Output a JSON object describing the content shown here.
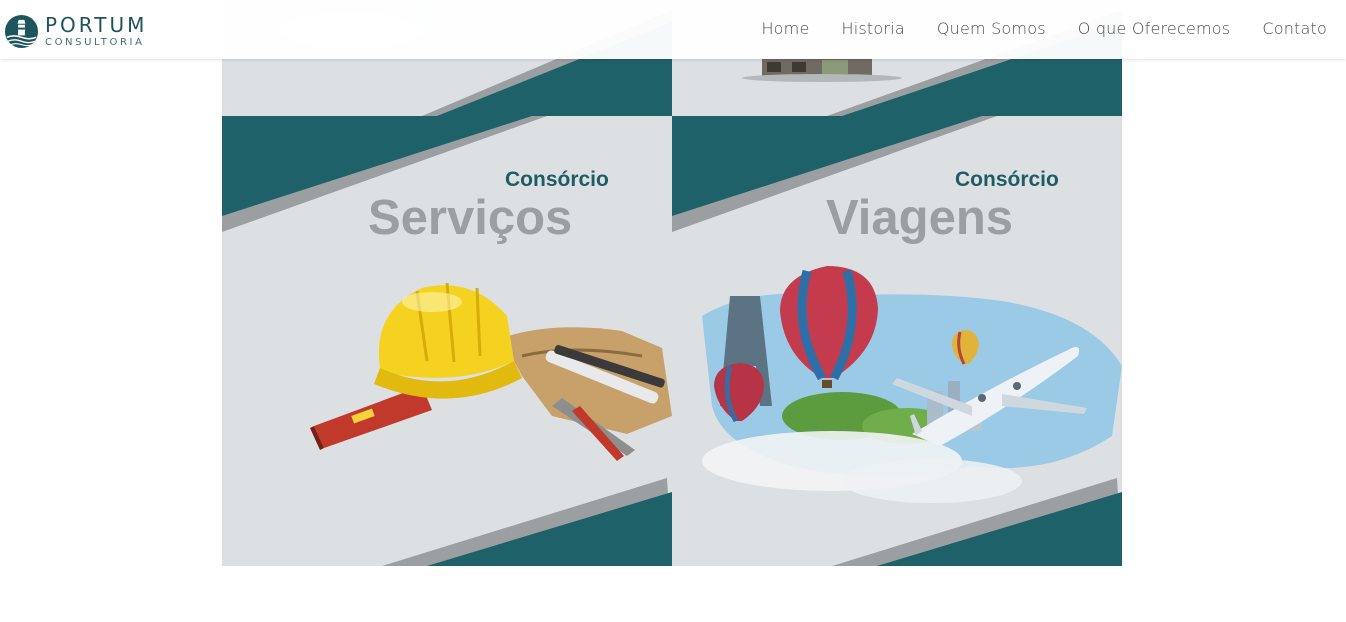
{
  "brand": {
    "name": "PORTUM",
    "subtitle": "CONSULTORIA",
    "colors": {
      "teal": "#1f6169",
      "gray": "#9b9fa2",
      "tile_bg": "#dde0e3"
    }
  },
  "nav": {
    "items": [
      {
        "label": "Home"
      },
      {
        "label": "Historia"
      },
      {
        "label": "Quem Somos"
      },
      {
        "label": "O que Oferecemos"
      },
      {
        "label": "Contato"
      }
    ]
  },
  "tiles": {
    "services": {
      "kicker": "Consórcio",
      "headline": "Serviços",
      "image": "hard-hat-and-tools"
    },
    "travel": {
      "kicker": "Consórcio",
      "headline": "Viagens",
      "image": "balloons-and-airplane"
    }
  }
}
